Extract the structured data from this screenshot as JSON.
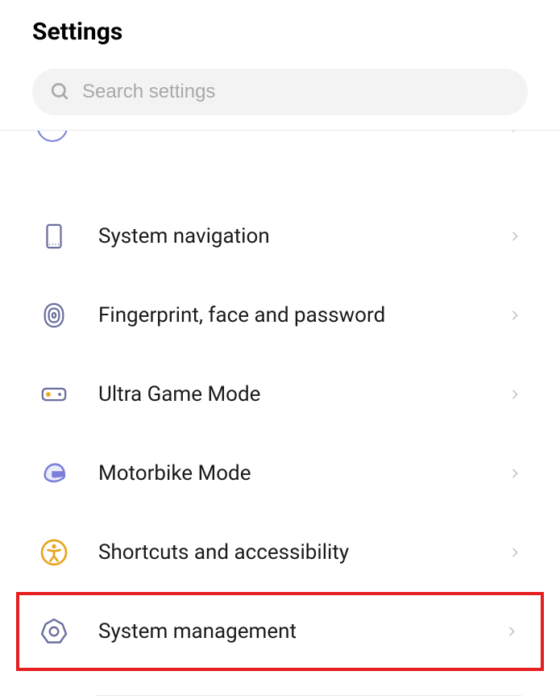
{
  "header": {
    "title": "Settings"
  },
  "search": {
    "placeholder": "Search settings"
  },
  "items": [
    {
      "label": "System navigation",
      "icon": "phone-nav",
      "highlighted": false
    },
    {
      "label": "Fingerprint, face and password",
      "icon": "fingerprint",
      "highlighted": false
    },
    {
      "label": "Ultra Game Mode",
      "icon": "gamepad",
      "highlighted": false
    },
    {
      "label": "Motorbike Mode",
      "icon": "helmet",
      "highlighted": false
    },
    {
      "label": "Shortcuts and accessibility",
      "icon": "accessibility",
      "highlighted": false
    },
    {
      "label": "System management",
      "icon": "gear",
      "highlighted": true
    }
  ],
  "colors": {
    "iconBlue": "#6b6f9e",
    "iconYellow": "#e8a520",
    "highlight": "#e51f1f"
  }
}
